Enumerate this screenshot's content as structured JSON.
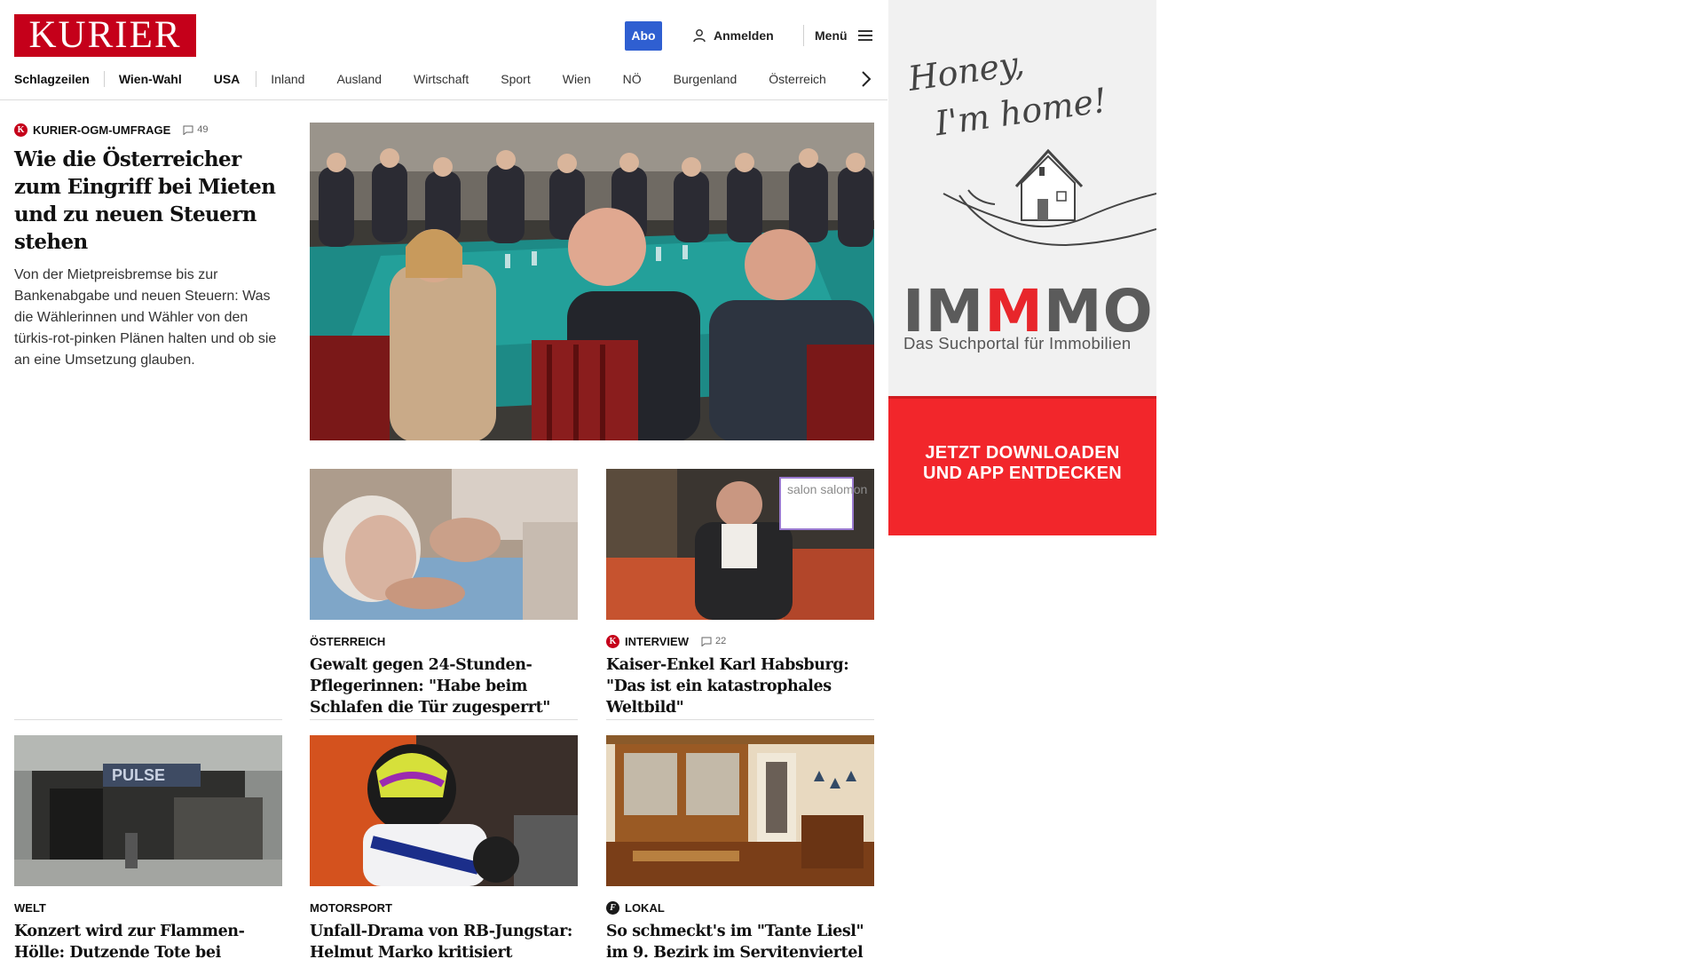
{
  "header": {
    "logo": "KURIER",
    "abo_label": "Abo",
    "login_label": "Anmelden",
    "menu_label": "Menü",
    "nav": [
      "Schlagzeilen",
      "Wien-Wahl",
      "USA",
      "Inland",
      "Ausland",
      "Wirtschaft",
      "Sport",
      "Wien",
      "NÖ",
      "Burgenland",
      "Österreich"
    ]
  },
  "lead": {
    "kicker": "KURIER-OGM-UMFRAGE",
    "comments": "49",
    "title": "Wie die Österreicher zum Eingriff bei Mieten und zu neuen Steuern stehen",
    "description": "Von der Mietpreisbremse bis zur Bankenabgabe und neuen Steuern: Was die Wählerinnen und Wähler von den türkis-rot-pinken Plänen halten und ob sie an eine Umsetzung glauben."
  },
  "cards": [
    {
      "kicker": "ÖSTERREICH",
      "title": "Gewalt gegen 24-Stunden-Pflegerinnen: \"Habe beim Schlafen die Tür zugesperrt\""
    },
    {
      "kicker": "INTERVIEW",
      "comments": "22",
      "badge_text": "salon salomon",
      "title": "Kaiser-Enkel Karl Habsburg: \"Das ist ein katastrophales Weltbild\""
    },
    {
      "kicker": "WELT",
      "sign_text": "PULSE",
      "title": "Konzert wird zur Flammen-Hölle: Dutzende Tote bei Nachtclub-Brand"
    },
    {
      "kicker": "MOTORSPORT",
      "title": "Unfall-Drama von RB-Jungstar: Helmut Marko kritisiert \"peinliche\" Tränen-Show"
    },
    {
      "kicker": "LOKAL",
      "title": "So schmeckt's im \"Tante Liesl\" im 9. Bezirk im Servitenviertel"
    }
  ],
  "ad": {
    "script_line1": "Honey,",
    "script_line2": "I'm home!",
    "logo_a": "IM",
    "logo_b": "M",
    "logo_c": "MO",
    "subtitle": "Das Suchportal für Immobilien",
    "cta_line1": "JETZT DOWNLOADEN",
    "cta_line2": "UND APP ENTDECKEN"
  },
  "colors": {
    "brand_red": "#c5001a",
    "abo_blue": "#2f5fd1",
    "ad_red": "#f2262b"
  }
}
